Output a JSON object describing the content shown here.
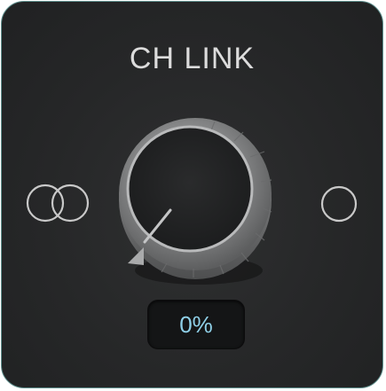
{
  "plugin": {
    "title": "CH LINK",
    "knob": {
      "value_percent": 0,
      "readout": "0%"
    },
    "icons": {
      "left": "linked-circles-icon",
      "right": "single-circle-icon"
    },
    "colors": {
      "border_accent": "#5f8f8d",
      "readout_text": "#8fd0e8",
      "panel_bg": "#262728"
    }
  }
}
